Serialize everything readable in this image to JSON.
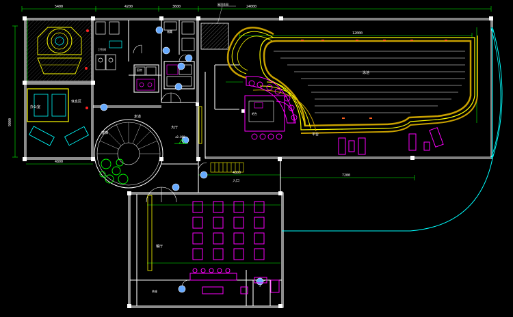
{
  "colors": {
    "background": "#000000",
    "wall": "#ffffff",
    "dimension": "#00ff00",
    "furniture_magenta": "#ff00ff",
    "furniture_cyan": "#00ffff",
    "pool_edge_yellow": "#ffff00",
    "pool_fill": "#c8a000",
    "marker_blue": "#66aaff",
    "accent_red": "#ff2020"
  },
  "labels": {
    "annotation_top": "屋顶花园",
    "dim_overall_top": "24000",
    "dim_left_top": "5400",
    "dim_mid_top": "4200",
    "dim_mid2_top": "3600",
    "dim_left_side": "9000",
    "dim_pool_length": "12000",
    "dim_lower_right": "7200",
    "dim_lower_mid": "4800",
    "dim_left_bottom": "4800",
    "room_pool": "泳池",
    "room_bar": "吧台",
    "room_dining": "餐厅",
    "room_office": "办公室",
    "room_corridor": "走道",
    "room_hall": "大厅",
    "room_terrace": "平台",
    "room_stair": "楼梯",
    "room_restroom": "卫生间",
    "room_store": "储藏",
    "room_lounge": "休息区",
    "room_entry": "入口",
    "room_kitchen": "厨房",
    "room_tea": "茶座",
    "level_mark": "±0.000"
  }
}
